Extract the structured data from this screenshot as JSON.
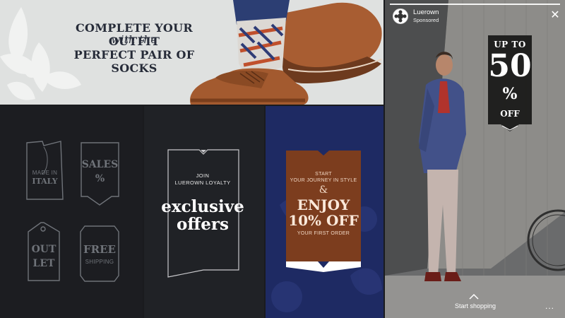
{
  "banner": {
    "line1": "COMPLETE YOUR OUTFIT",
    "line2": "with the",
    "line3": "PERFECT PAIR OF SOCKS"
  },
  "tags": {
    "made_in": "MADE IN",
    "italy": "ITALY",
    "sales": "SALES",
    "percent": "%",
    "out": "OUT",
    "let": "LET",
    "free": "FREE",
    "shipping": "SHIPPING"
  },
  "loyalty": {
    "line1": "JOIN",
    "line2": "LUEROWN LOYALTY",
    "headline1": "exclusive",
    "headline2": "offers"
  },
  "offer": {
    "line1": "START",
    "line2": "YOUR JOURNEY IN STYLE",
    "amp": "&",
    "enjoy": "ENJOY",
    "pct": "10% OFF",
    "line3": "YOUR FIRST ORDER"
  },
  "story": {
    "brand": "Luerown",
    "sponsored": "Sponsored",
    "up_to": "UP TO",
    "fifty": "50",
    "percent": "%",
    "off": "OFF",
    "cta": "Start shopping",
    "more": "..."
  },
  "colors": {
    "navy_panel": "#1e2a63",
    "offer_brown": "#7c3d1e",
    "dark_panel": "#1c1d21",
    "banner_bg": "#dfe1e0"
  }
}
